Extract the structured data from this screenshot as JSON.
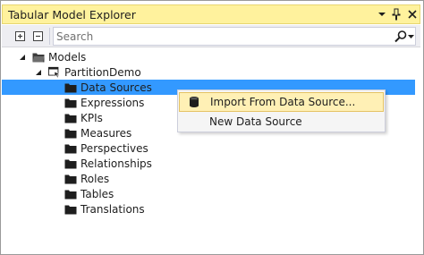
{
  "window": {
    "title": "Tabular Model Explorer"
  },
  "toolbar": {
    "search_placeholder": "Search"
  },
  "tree": {
    "root": "Models",
    "model": "PartitionDemo",
    "children": [
      "Data Sources",
      "Expressions",
      "KPIs",
      "Measures",
      "Perspectives",
      "Relationships",
      "Roles",
      "Tables",
      "Translations"
    ],
    "selected": "Data Sources"
  },
  "context_menu": {
    "items": [
      {
        "label": "Import From Data Source...",
        "icon": "database-icon"
      },
      {
        "label": "New Data Source",
        "icon": ""
      }
    ]
  },
  "colors": {
    "title_bar": "#fff29d",
    "selection": "#3399ff",
    "menu_hover": "#fff0b5"
  }
}
